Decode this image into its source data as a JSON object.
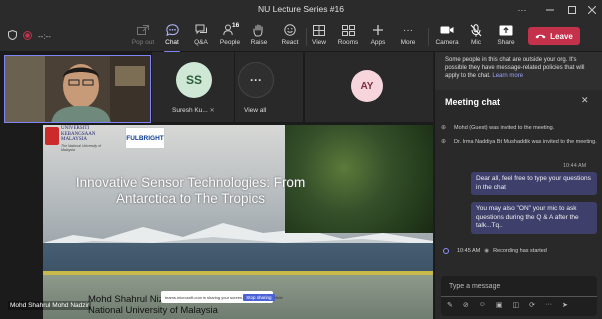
{
  "window": {
    "title": "NU Lecture Series #16"
  },
  "toolbar": {
    "timer": "--:--",
    "buttons": [
      {
        "key": "popout",
        "label": "Pop out"
      },
      {
        "key": "chat",
        "label": "Chat"
      },
      {
        "key": "qa",
        "label": "Q&A"
      },
      {
        "key": "people",
        "label": "People",
        "count": "16"
      },
      {
        "key": "raise",
        "label": "Raise"
      },
      {
        "key": "react",
        "label": "React"
      },
      {
        "key": "view",
        "label": "View"
      },
      {
        "key": "rooms",
        "label": "Rooms"
      },
      {
        "key": "apps",
        "label": "Apps"
      },
      {
        "key": "more",
        "label": "More"
      },
      {
        "key": "camera",
        "label": "Camera"
      },
      {
        "key": "mic",
        "label": "Mic"
      },
      {
        "key": "share",
        "label": "Share"
      }
    ],
    "leave_label": "Leave",
    "accent": "#7f85f5",
    "leave_color": "#c4314b"
  },
  "stage": {
    "participants": [
      {
        "initials": "SS",
        "name": "Suresh Ku...",
        "avatar_color": "#cfe8d6",
        "text_color": "#2b5e3b"
      },
      {
        "initials": "···",
        "name": "View all"
      },
      {
        "initials": "AY",
        "avatar_color": "#f6d6dc",
        "text_color": "#7a2f3d"
      }
    ],
    "slide": {
      "title": "Innovative Sensor Technologies: From Antarctica to The Tropics",
      "logo_left": "UNIVERSITI KEBANGSAAN MALAYSIA",
      "logo_left_sub": "The National University of Malaysia",
      "logo_right": "FULBRIGHT",
      "presenter_line1": "Mohd Shahrul Nizam Mohd",
      "presenter_line2": "National University of Malaysia",
      "share_note": "teams.microsoft.com is sharing your screen.",
      "share_button": "Stop sharing",
      "hide_button": "Hide"
    },
    "presenter_name": "Mohd Shahrul Mohd Nadzir"
  },
  "chat": {
    "notice": "Some people in this chat are outside your org. It's possible they have message-related policies that will apply to the chat.",
    "notice_link": "Learn more",
    "title": "Meeting chat",
    "system_messages": [
      "Mohd (Guest) was invited to the meeting.",
      "Dr. Irma Naddiya Bt Mushaddik was invited to the meeting."
    ],
    "timestamp": "10:44 AM",
    "messages": [
      "Dear all, feel free to type your questions in the chat",
      "You may also \"ON\" your mic to ask questions during the Q & A after the talk...Tq.."
    ],
    "status_time": "10:45 AM",
    "status_text": "Recording has started",
    "compose_placeholder": "Type a message"
  }
}
